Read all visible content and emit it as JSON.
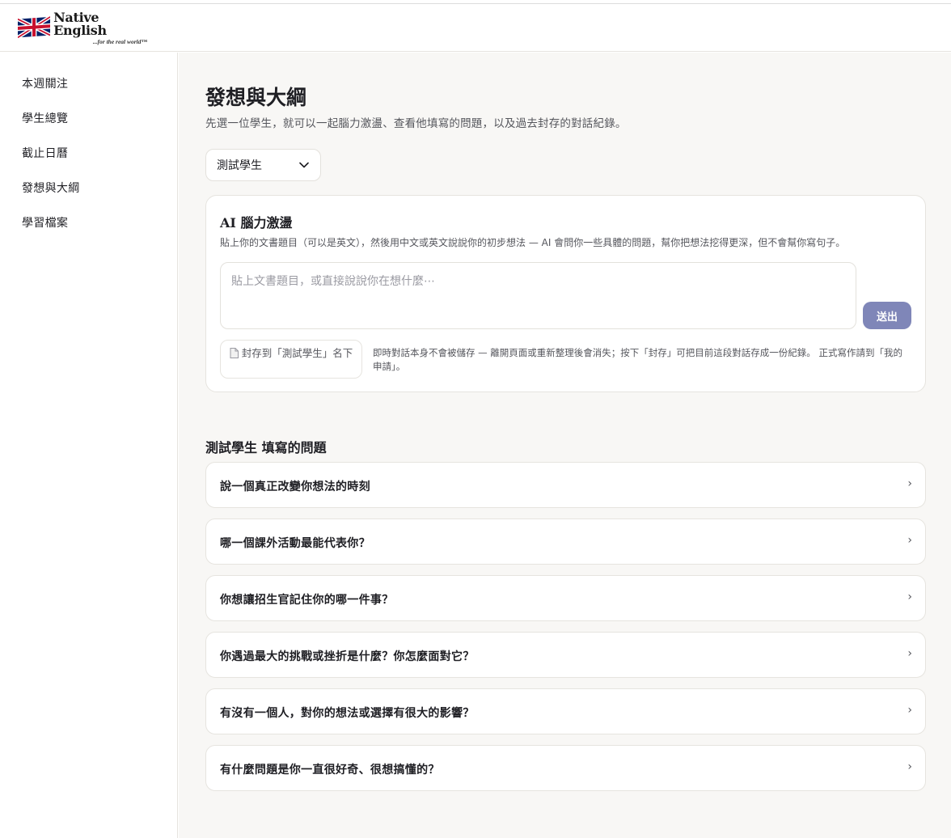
{
  "brand": {
    "name": "Native English",
    "tagline": "...for the real world™",
    "logo_icon": "union-jack-flag-icon"
  },
  "sidebar": {
    "items": [
      {
        "label": "本週關注"
      },
      {
        "label": "學生總覽"
      },
      {
        "label": "截止日曆"
      },
      {
        "label": "發想與大綱"
      },
      {
        "label": "學習檔案"
      }
    ]
  },
  "main": {
    "title": "發想與大綱",
    "subtitle": "先選一位學生，就可以一起腦力激盪、查看他填寫的問題，以及過去封存的對話紀錄。",
    "student_select": {
      "value": "測試學生",
      "icon": "chevron-down-icon"
    }
  },
  "ai_card": {
    "title": "AI 腦力激盪",
    "description": "貼上你的文書題目（可以是英文），然後用中文或英文說說你的初步想法 — AI 會問你一些具體的問題，幫你把想法挖得更深，但不會幫你寫句子。",
    "input_placeholder": "貼上文書題目，或直接說說你在想什麼⋯",
    "input_value": "",
    "send_label": "送出",
    "archive_label": "封存到「測試學生」名下",
    "archive_icon": "document-icon",
    "archive_note": "即時對話本身不會被儲存 — 離開頁面或重新整理後會消失；按下「封存」可把目前這段對話存成一份紀錄。 正式寫作請到「我的申請」。"
  },
  "questions": {
    "heading": "測試學生 填寫的問題",
    "items": [
      {
        "label": "說一個真正改變你想法的時刻",
        "chevron": "›"
      },
      {
        "label": "哪一個課外活動最能代表你？",
        "chevron": "›"
      },
      {
        "label": "你想讓招生官記住你的哪一件事？",
        "chevron": "›"
      },
      {
        "label": "你遇過最大的挑戰或挫折是什麼？你怎麼面對它？",
        "chevron": "›"
      },
      {
        "label": "有沒有一個人，對你的想法或選擇有很大的影響？",
        "chevron": "›"
      },
      {
        "label": "有什麼問題是你一直很好奇、很想搞懂的？",
        "chevron": "›"
      }
    ]
  },
  "colors": {
    "accent": "#7f86b8",
    "main_background": "#f8f7f5",
    "card_border": "#e6e4df"
  }
}
